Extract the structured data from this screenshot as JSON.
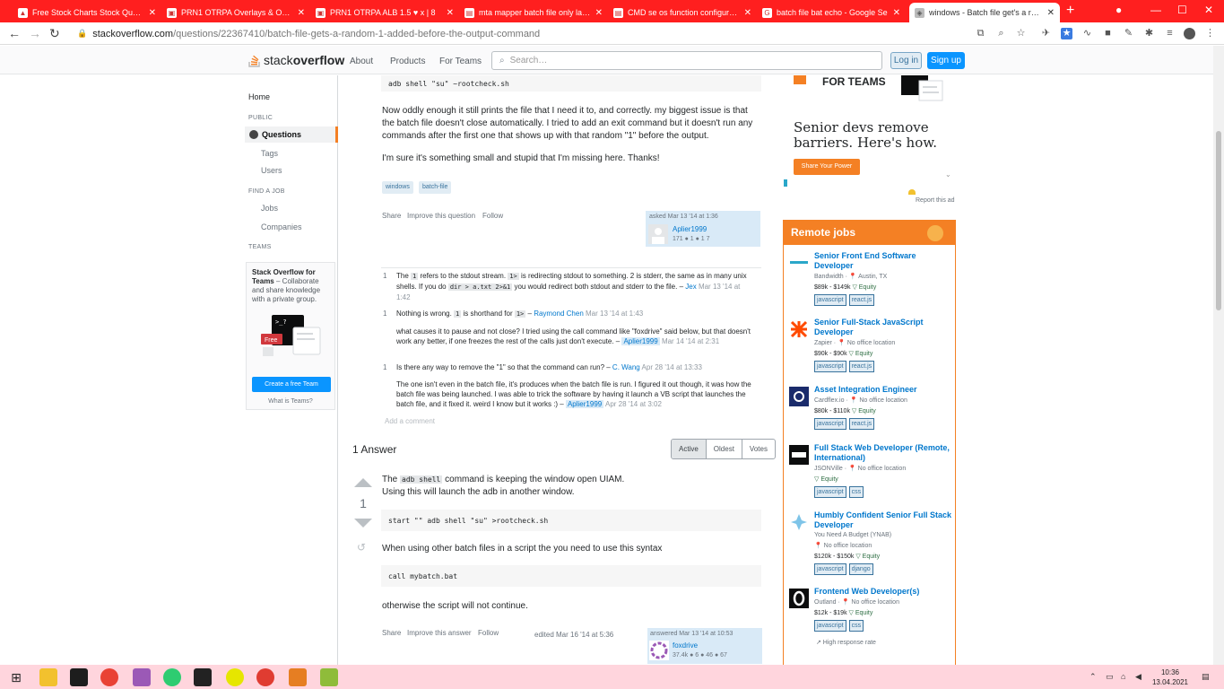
{
  "browser": {
    "tabs": [
      {
        "title": "Free Stock Charts Stock Quotes",
        "active": false
      },
      {
        "title": "PRN1 OTRPA Overlays & Opcode",
        "active": false
      },
      {
        "title": "PRN1 OTRPA ALB 1.5 ♥ x | 8",
        "active": false
      },
      {
        "title": "mta mapper batch file only launch",
        "active": false
      },
      {
        "title": "CMD se os function configuration",
        "active": false
      },
      {
        "title": "batch file bat echo - Google Se",
        "active": false
      },
      {
        "title": "windows - Batch file get's a rand",
        "active": true
      }
    ],
    "url_host": "stackoverflow.com",
    "url_path": "/questions/22367410/batch-file-gets-a-random-1-added-before-the-output-command"
  },
  "so_header": {
    "logo_a": "stack",
    "logo_b": "overflow",
    "nav": [
      "About",
      "Products",
      "For Teams"
    ],
    "search_placeholder": "Search…",
    "login": "Log in",
    "signup": "Sign up"
  },
  "leftnav": {
    "home": "Home",
    "public_head": "PUBLIC",
    "questions": "Questions",
    "tags": "Tags",
    "users": "Users",
    "findjob_head": "FIND A JOB",
    "jobs": "Jobs",
    "companies": "Companies",
    "teams_head": "TEAMS",
    "teams_title": "Stack Overflow for Teams",
    "teams_desc": " – Collaborate and share knowledge with a private group.",
    "teams_btn": "Create a free Team",
    "teams_what": "What is Teams?",
    "teams_art_label": "Free"
  },
  "question": {
    "code_top": "adb shell \"su\" ~rootcheck.sh",
    "p1": "Now oddly enough it still prints the file that I need it to, and correctly. my biggest issue is that the batch file doesn't close automatically. I tried to add an exit command but it doesn't run any commands after the first one that shows up with that random \"1\" before the output.",
    "p2": "I'm sure it's something small and stupid that I'm missing here. Thanks!",
    "tags": [
      "windows",
      "batch-file"
    ],
    "menu": [
      "Share",
      "Improve this question",
      "Follow"
    ],
    "asked": "asked Mar 13 '14 at 1:36",
    "asker": "Aplier1999",
    "asker_rep": "171 ● 1 ● 1 7"
  },
  "comments": [
    {
      "score": "1",
      "text_a": "The ",
      "code1": "1",
      "text_b": " refers to the stdout stream. ",
      "code2": "1>",
      "text_c": " is redirecting stdout to something. 2 is stderr, the same as in many unix shells. If you do ",
      "code3": "dir > a.txt 2>&1",
      "text_d": " you would redirect both stdout and stderr to the file. – ",
      "author": "Jex",
      "date": "Mar 13 '14 at 1:42"
    },
    {
      "score": "1",
      "text_a": "Nothing is wrong. ",
      "code1": "1",
      "text_b": " is shorthand for ",
      "code2": "1>",
      "text_c": " – ",
      "author": "Raymond Chen",
      "date": "Mar 13 '14 at 1:43"
    },
    {
      "score": "",
      "text_a": "what causes it to pause and not close? I tried using the call command like \"foxdrive\" said below, but that doesn't work any better, if one freezes the rest of the calls just don't execute. – ",
      "author": "Aplier1999",
      "date": "Mar 14 '14 at 2:31"
    },
    {
      "score": "1",
      "text_a": "Is there any way to remove the \"1\" so that the command can run? – ",
      "author": "C. Wang",
      "date": "Apr 28 '14 at 13:33"
    },
    {
      "score": "",
      "text_a": "The one isn't even in the batch file, it's produces when the batch file is run. I figured it out though, it was how the batch file was being launched. I was able to trick the software by having it launch a VB script that launches the batch file, and it fixed it. weird I know but it works :) – ",
      "author": "Aplier1999",
      "date": "Apr 28 '14 at 3:02"
    }
  ],
  "add_comment": "Add a comment",
  "answers": {
    "count_label": "1 Answer",
    "sort": [
      "Active",
      "Oldest",
      "Votes"
    ],
    "vote_count": "1",
    "a_p1a": "The ",
    "a_code_inline": "adb shell",
    "a_p1b": " command is keeping the window open UIAM.",
    "a_p2": "Using this will launch the adb in another window.",
    "a_code1": "start \"\" adb shell \"su\" >rootcheck.sh",
    "a_p3": "When using other batch files in a script the you need to use this syntax",
    "a_code2": "call mybatch.bat",
    "a_p4": "otherwise the script will not continue.",
    "menu": [
      "Share",
      "Improve this answer",
      "Follow"
    ],
    "edited": "edited Mar 16 '14 at 5:36",
    "answered": "answered Mar 13 '14 at 10:53",
    "answerer": "foxdrive",
    "answerer_rep": "37.4k ● 6 ● 46 ● 67"
  },
  "ad": {
    "for_teams": "FOR TEAMS",
    "headline": "Senior devs remove barriers. Here's how.",
    "button": "Share Your Power",
    "report": "Report this ad"
  },
  "jobs": {
    "header": "Remote jobs",
    "list": [
      {
        "title": "Senior Front End Software Developer",
        "company": "Bandwidth  ·  📍 Austin, TX",
        "pay": "$89k - $149k",
        "equity": "▽ Equity",
        "tags": [
          "javascript",
          "react.js"
        ]
      },
      {
        "title": "Senior Full-Stack JavaScript Developer",
        "company": "Zapier  ·  📍 No office location",
        "pay": "$90k - $90k",
        "equity": "▽ Equity",
        "tags": [
          "javascript",
          "react.js"
        ]
      },
      {
        "title": "Asset Integration Engineer",
        "company": "Cardflex.io  ·  📍 No office location",
        "pay": "$80k - $110k",
        "equity": "▽ Equity",
        "tags": [
          "javascript",
          "react.js"
        ]
      },
      {
        "title": "Full Stack Web Developer (Remote, International)",
        "company": "JSONVille  ·  📍 No office location",
        "pay": "",
        "equity": "▽ Equity",
        "tags": [
          "javascript",
          "css"
        ]
      },
      {
        "title": "Humbly Confident Senior Full Stack Developer",
        "company": "You Need A Budget (YNAB)",
        "company2": "📍 No office location",
        "pay": "$120k - $150k",
        "equity": "▽ Equity",
        "tags": [
          "javascript",
          "django"
        ]
      },
      {
        "title": "Frontend Web Developer(s)",
        "company": "Outland  ·  📍 No office location",
        "pay": "$12k - $19k",
        "equity": "▽ Equity",
        "tags": [
          "javascript",
          "css"
        ]
      }
    ],
    "high_response": "↗ High response rate"
  },
  "taskbar": {
    "time": "10:36",
    "date": "13.04.2021"
  }
}
